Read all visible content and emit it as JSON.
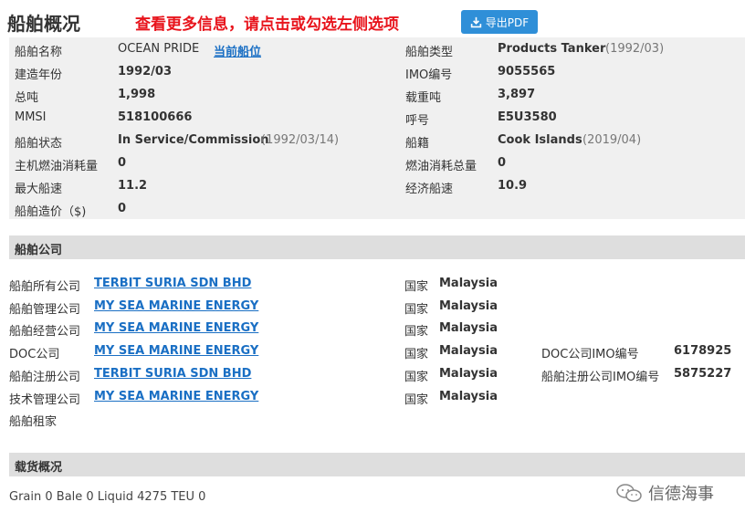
{
  "header": {
    "title": "船舶概况",
    "hint": "查看更多信息，请点击或勾选左侧选项",
    "export_pdf": "导出PDF"
  },
  "overview": {
    "left": [
      {
        "label": "船舶名称",
        "value": "OCEAN PRIDE",
        "link": "当前船位"
      },
      {
        "label": "建造年份",
        "value": "1992/03"
      },
      {
        "label": "总吨",
        "value": "1,998"
      },
      {
        "label": "MMSI",
        "value": "518100666"
      },
      {
        "label": "船舶状态",
        "value": "In Service/Commission",
        "date": "(1992/03/14)"
      },
      {
        "label": "主机燃油消耗量",
        "value": "0"
      },
      {
        "label": "最大船速",
        "value": "11.2"
      },
      {
        "label": "船舶造价（$)",
        "value": "0"
      }
    ],
    "right": [
      {
        "label": "船舶类型",
        "value": "Products Tanker",
        "date": "(1992/03)"
      },
      {
        "label": "IMO编号",
        "value": "9055565"
      },
      {
        "label": "载重吨",
        "value": "3,897"
      },
      {
        "label": "呼号",
        "value": "E5U3580"
      },
      {
        "label": "船籍",
        "value": "Cook Islands",
        "date": "(2019/04)"
      },
      {
        "label": "燃油消耗总量",
        "value": "0"
      },
      {
        "label": "经济船速",
        "value": "10.9"
      }
    ]
  },
  "company": {
    "section_title": "船舶公司",
    "country_label": "国家",
    "rows": [
      {
        "label": "船舶所有公司",
        "name": "TERBIT SURIA SDN BHD",
        "country": "Malaysia"
      },
      {
        "label": "船舶管理公司",
        "name": "MY SEA MARINE ENERGY",
        "country": "Malaysia"
      },
      {
        "label": "船舶经营公司",
        "name": "MY SEA MARINE ENERGY",
        "country": "Malaysia"
      },
      {
        "label": "DOC公司",
        "name": "MY SEA MARINE ENERGY",
        "country": "Malaysia",
        "extra_label": "DOC公司IMO编号",
        "extra_value": "6178925"
      },
      {
        "label": "船舶注册公司",
        "name": "TERBIT SURIA SDN BHD",
        "country": "Malaysia",
        "extra_label": "船舶注册公司IMO编号",
        "extra_value": "5875227"
      },
      {
        "label": "技术管理公司",
        "name": "MY SEA MARINE ENERGY",
        "country": "Malaysia"
      },
      {
        "label": "船舶租家"
      }
    ]
  },
  "cargo": {
    "section_title": "载货概况",
    "summary": "Grain 0 Bale 0 Liquid 4275 TEU 0"
  },
  "watermark": {
    "text": "信德海事"
  }
}
